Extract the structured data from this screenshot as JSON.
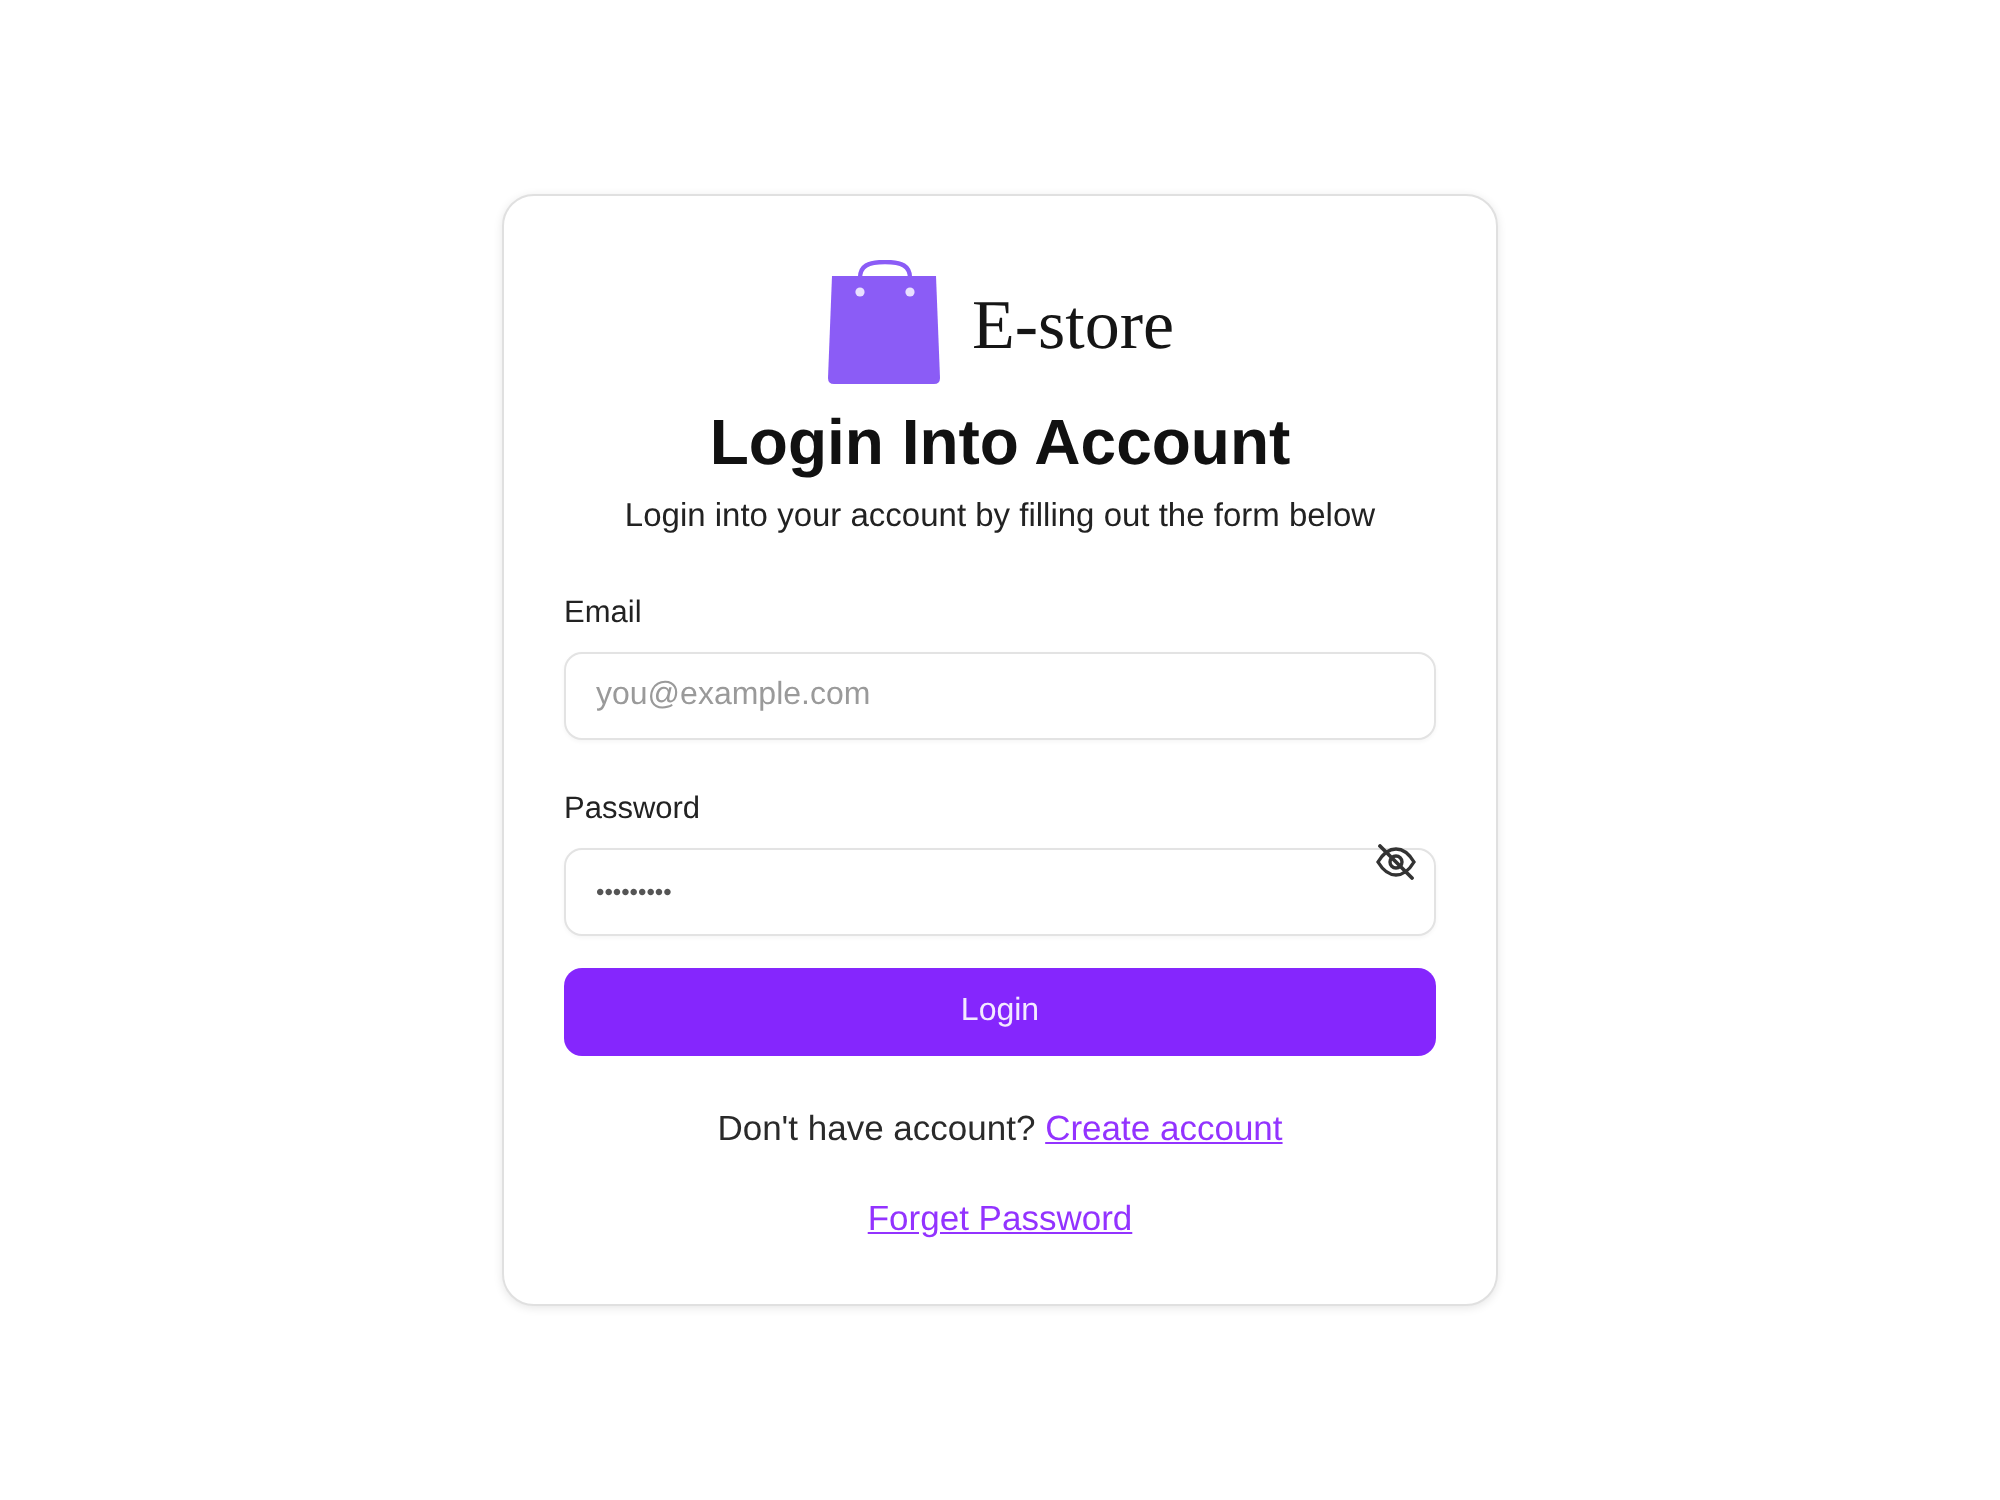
{
  "brand": {
    "name": "E-store"
  },
  "heading": {
    "title": "Login Into Account",
    "subtitle": "Login into your account by filling out the form below"
  },
  "fields": [
    {
      "kind": "email",
      "label": "Email",
      "placeholder": "you@example.com"
    },
    {
      "kind": "password",
      "label": "Password",
      "value": "•••••••••",
      "revealed": false
    }
  ],
  "submit": {
    "label": "Login"
  },
  "signup": {
    "prompt": "Don't have account?",
    "link": "Create account"
  },
  "forgot": {
    "link": "Forget Password"
  }
}
